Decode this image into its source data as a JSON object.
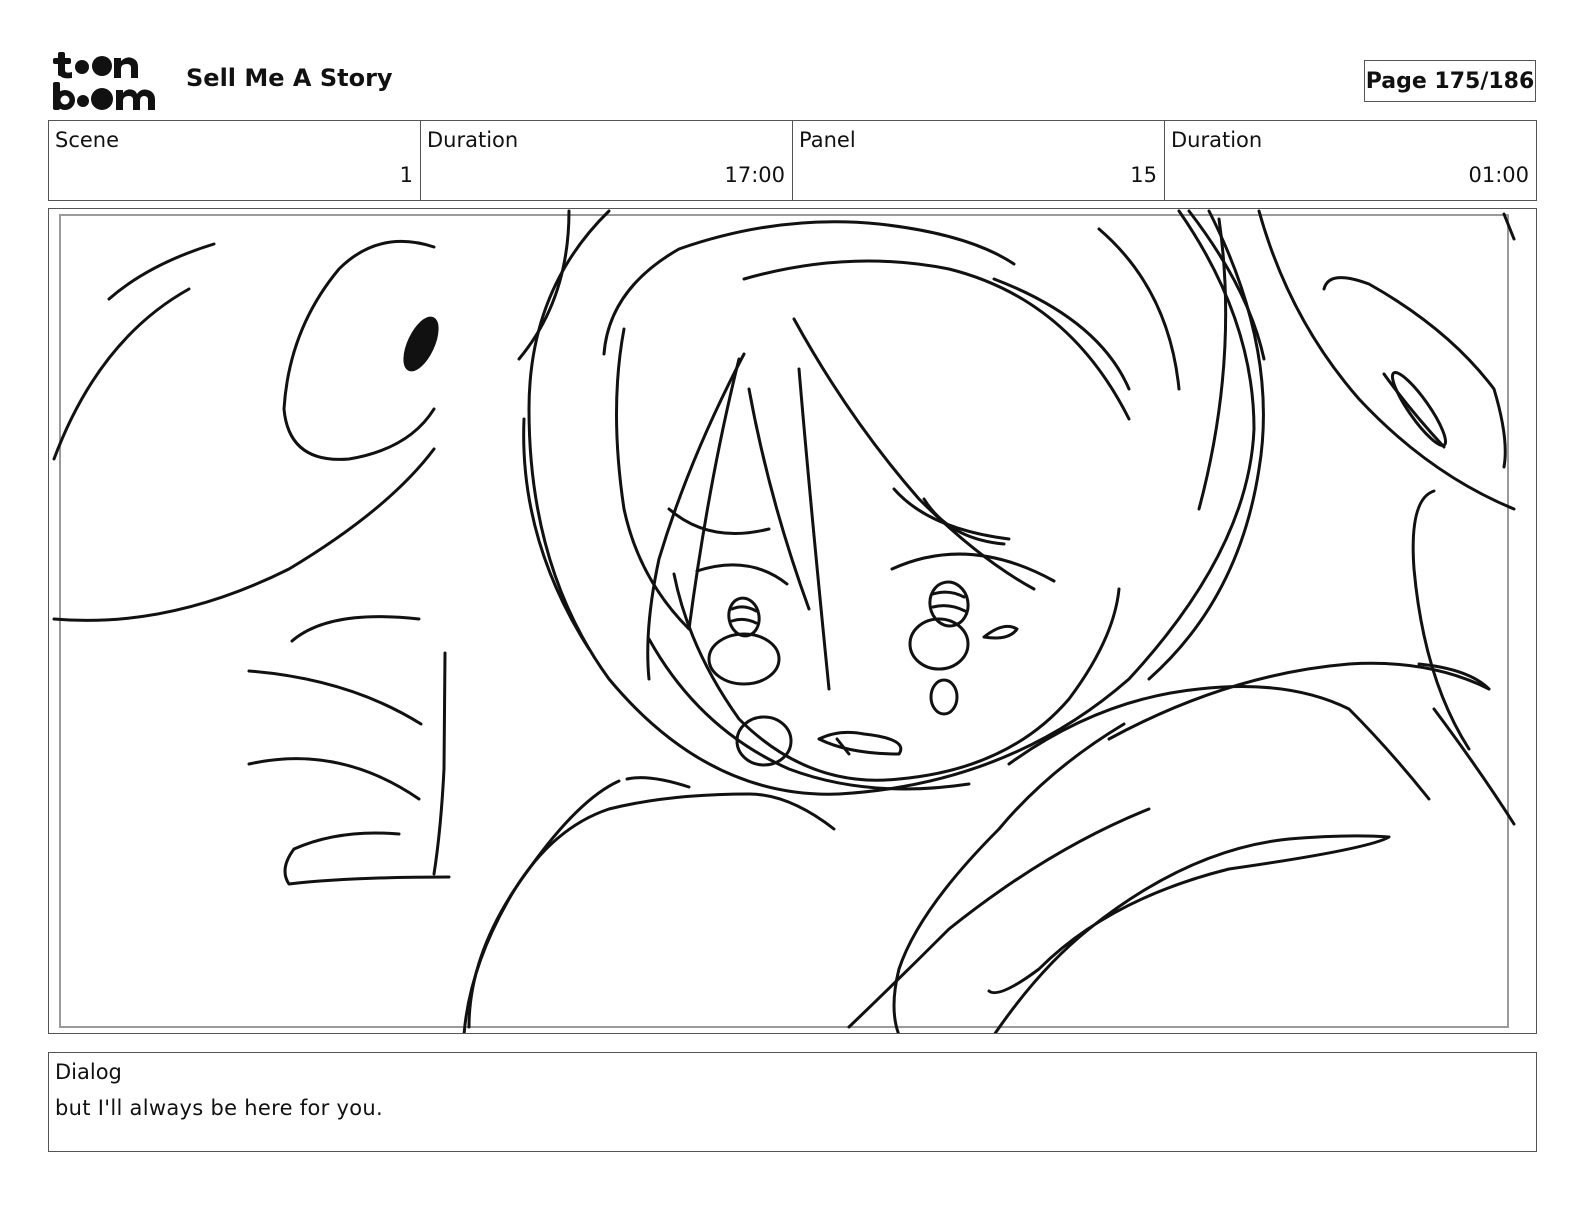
{
  "header": {
    "logo_text": "toon boom",
    "project_title": "Sell Me A Story",
    "page_label": "Page 175/186"
  },
  "info": {
    "scene_label": "Scene",
    "scene_value": "1",
    "scene_duration_label": "Duration",
    "scene_duration_value": "17:00",
    "panel_label": "Panel",
    "panel_value": "15",
    "panel_duration_label": "Duration",
    "panel_duration_value": "01:00"
  },
  "dialog": {
    "label": "Dialog",
    "text": "but I'll always be here for you."
  }
}
